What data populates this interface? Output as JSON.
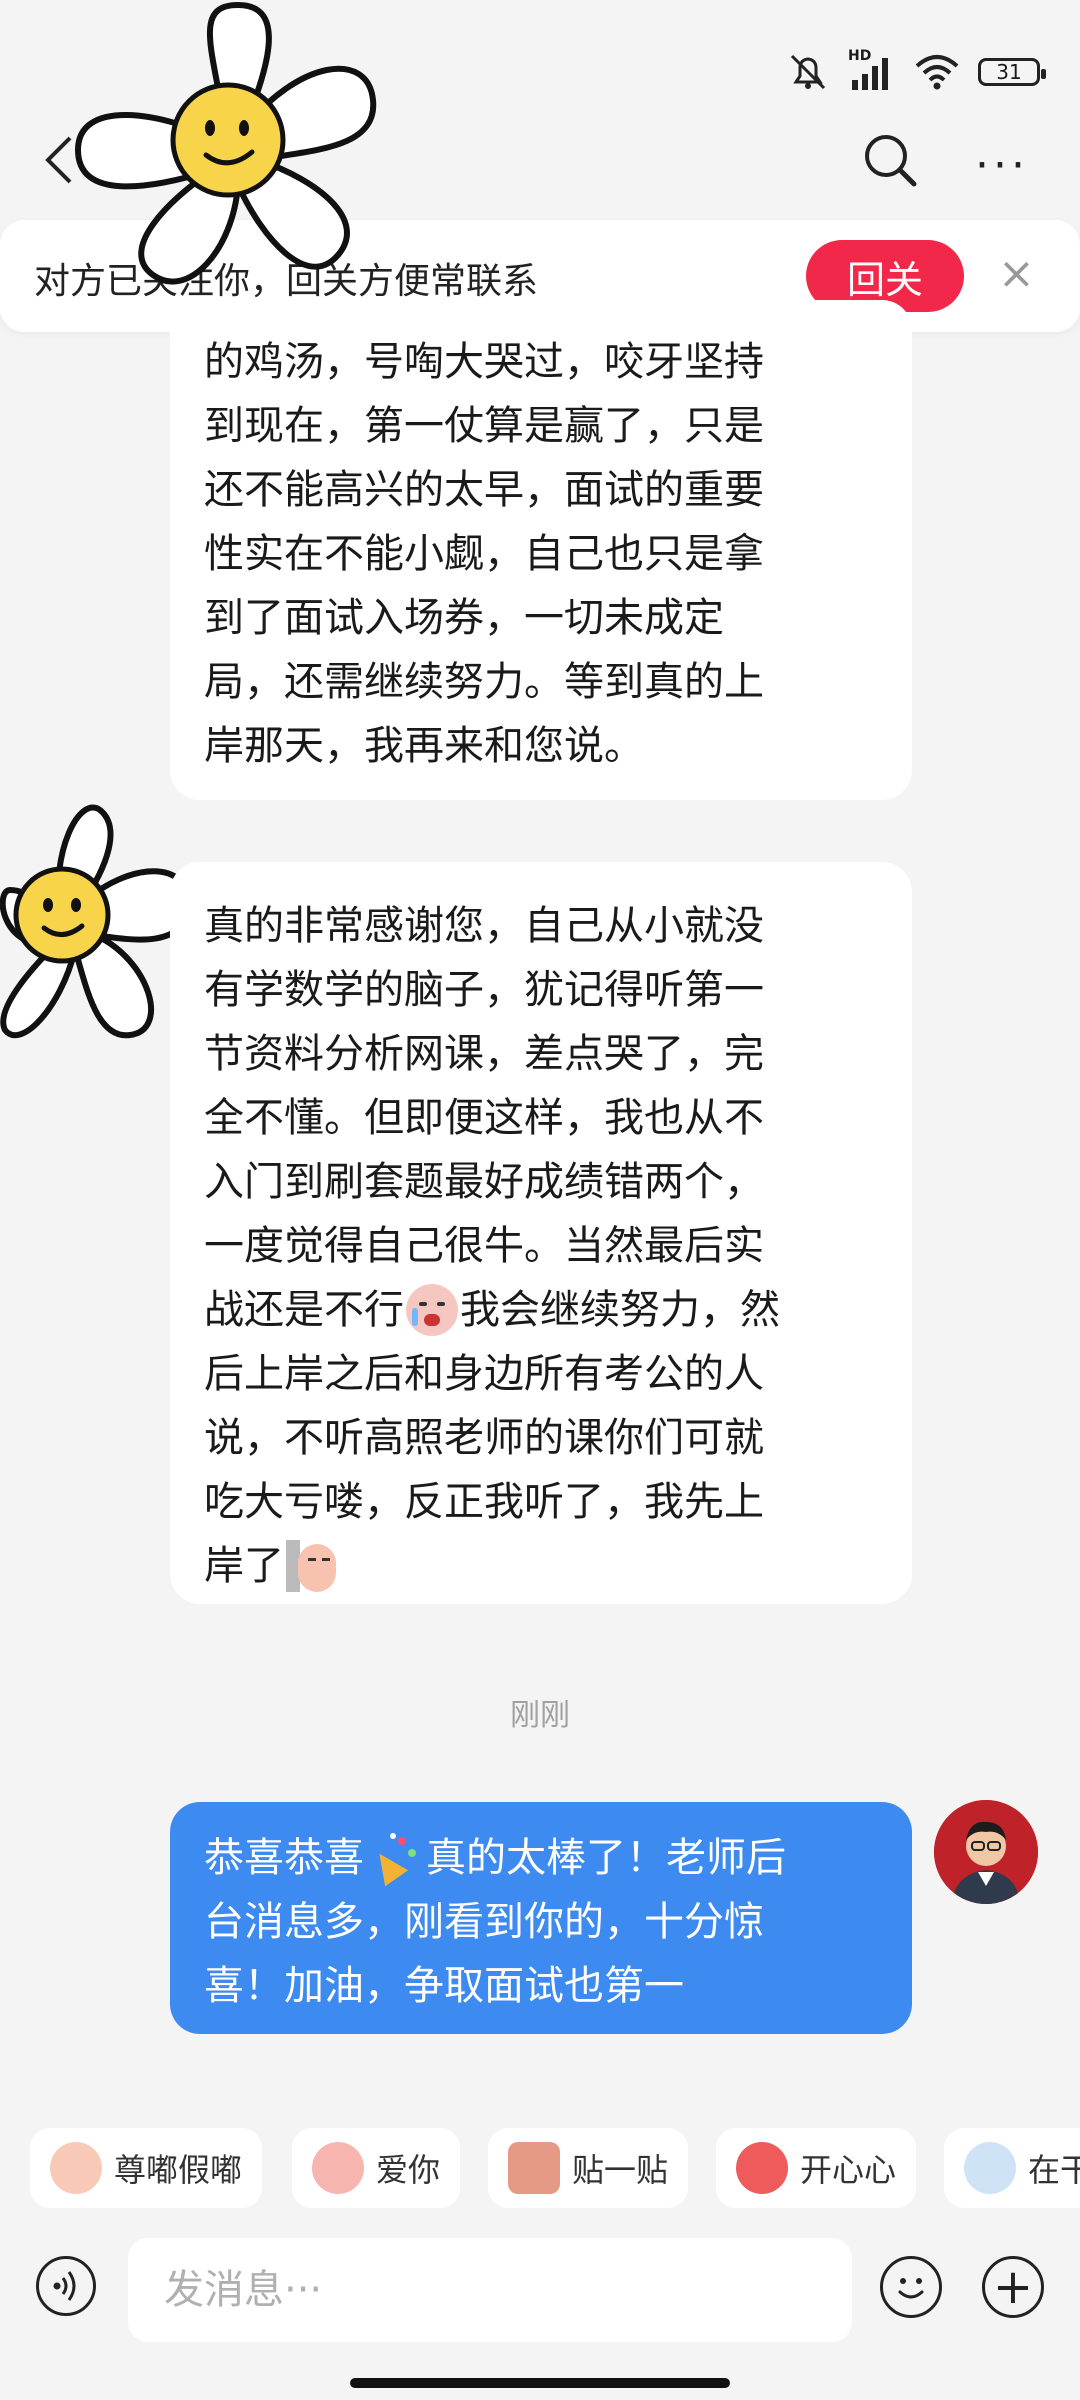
{
  "status_bar": {
    "battery": "31",
    "signal_label": "HD",
    "icons": [
      "mute-bell-icon",
      "signal-icon",
      "wifi-icon",
      "battery-icon"
    ]
  },
  "header": {
    "icons": [
      "back-icon",
      "search-icon",
      "more-icon"
    ]
  },
  "banner": {
    "text": "对方已关注你，回关方便常联系",
    "button": "回关",
    "close_icon": "×"
  },
  "messages": [
    {
      "direction": "incoming",
      "lines": [
        "的鸡汤，号啕大哭过，咬牙坚持",
        "到现在，第一仗算是赢了，只是",
        "还不能高兴的太早，面试的重要",
        "性实在不能小觑，自己也只是拿",
        "到了面试入场券，一切未成定",
        "局，还需继续努力。等到真的上",
        "岸那天，我再来和您说。"
      ]
    },
    {
      "direction": "incoming",
      "lines": [
        "真的非常感谢您，自己从小就没",
        "有学数学的脑子，犹记得听第一",
        "节资料分析网课，差点哭了，完",
        "全不懂。但即便这样，我也从不",
        "入门到刷套题最好成绩错两个，",
        "一度觉得自己很牛。当然最后实",
        "战还是不行",
        "我会继续努力，然",
        "后上岸之后和身边所有考公的人",
        "说，不听高照老师的课你们可就",
        "吃大亏喽，反正我听了，我先上",
        "岸了"
      ]
    },
    {
      "direction": "outgoing",
      "lines": [
        "恭喜恭喜",
        "真的太棒了！老师后",
        "台消息多，刚看到你的，十分惊",
        "喜！加油，争取面试也第一"
      ]
    }
  ],
  "timestamp": "刚刚",
  "quick_stickers": [
    "尊嘟假嘟",
    "爱你",
    "贴一贴",
    "开心心",
    "在干"
  ],
  "input": {
    "placeholder": "发消息···"
  },
  "colors": {
    "accent_red": "#f2284a",
    "outgoing_bubble": "#3d8af1",
    "background": "#f4f4f4"
  }
}
